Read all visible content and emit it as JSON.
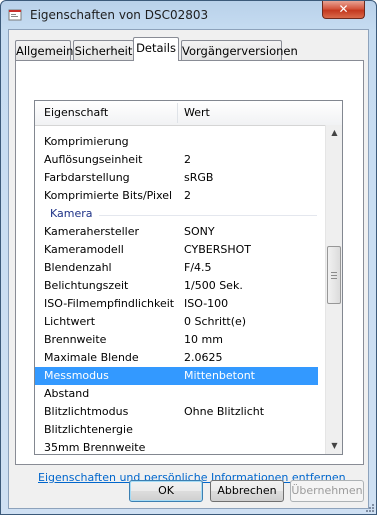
{
  "window": {
    "title": "Eigenschaften von DSC02803",
    "close_glyph": "✕",
    "icon": "properties-icon"
  },
  "tabs": [
    {
      "label": "Allgemein",
      "active": false
    },
    {
      "label": "Sicherheit",
      "active": false
    },
    {
      "label": "Details",
      "active": true
    },
    {
      "label": "Vorgängerversionen",
      "active": false
    }
  ],
  "table": {
    "headers": {
      "property": "Eigenschaft",
      "value": "Wert"
    },
    "rows": [
      {
        "property": "Komprimierung",
        "value": ""
      },
      {
        "property": "Auflösungseinheit",
        "value": "2"
      },
      {
        "property": "Farbdarstellung",
        "value": "sRGB"
      },
      {
        "property": "Komprimierte Bits/Pixel",
        "value": "2"
      },
      {
        "group": "Kamera"
      },
      {
        "property": "Kamerahersteller",
        "value": "SONY"
      },
      {
        "property": "Kameramodell",
        "value": "CYBERSHOT"
      },
      {
        "property": "Blendenzahl",
        "value": "F/4.5"
      },
      {
        "property": "Belichtungszeit",
        "value": "1/500 Sek."
      },
      {
        "property": "ISO-Filmempfindlichkeit",
        "value": "ISO-100"
      },
      {
        "property": "Lichtwert",
        "value": "0 Schritt(e)"
      },
      {
        "property": "Brennweite",
        "value": "10 mm"
      },
      {
        "property": "Maximale Blende",
        "value": "2.0625"
      },
      {
        "property": "Messmodus",
        "value": "Mittenbetont",
        "selected": true
      },
      {
        "property": "Abstand",
        "value": ""
      },
      {
        "property": "Blitzlichtmodus",
        "value": "Ohne Blitzlicht"
      },
      {
        "property": "Blitzlichtenergie",
        "value": ""
      },
      {
        "property": "35mm Brennweite",
        "value": ""
      }
    ]
  },
  "link": "Eigenschaften und persönliche Informationen entfernen",
  "buttons": {
    "ok": "OK",
    "cancel": "Abbrechen",
    "apply": "Übernehmen"
  },
  "colors": {
    "selection": "#3399ff",
    "group_header": "#1e3287",
    "link": "#0066cc"
  }
}
